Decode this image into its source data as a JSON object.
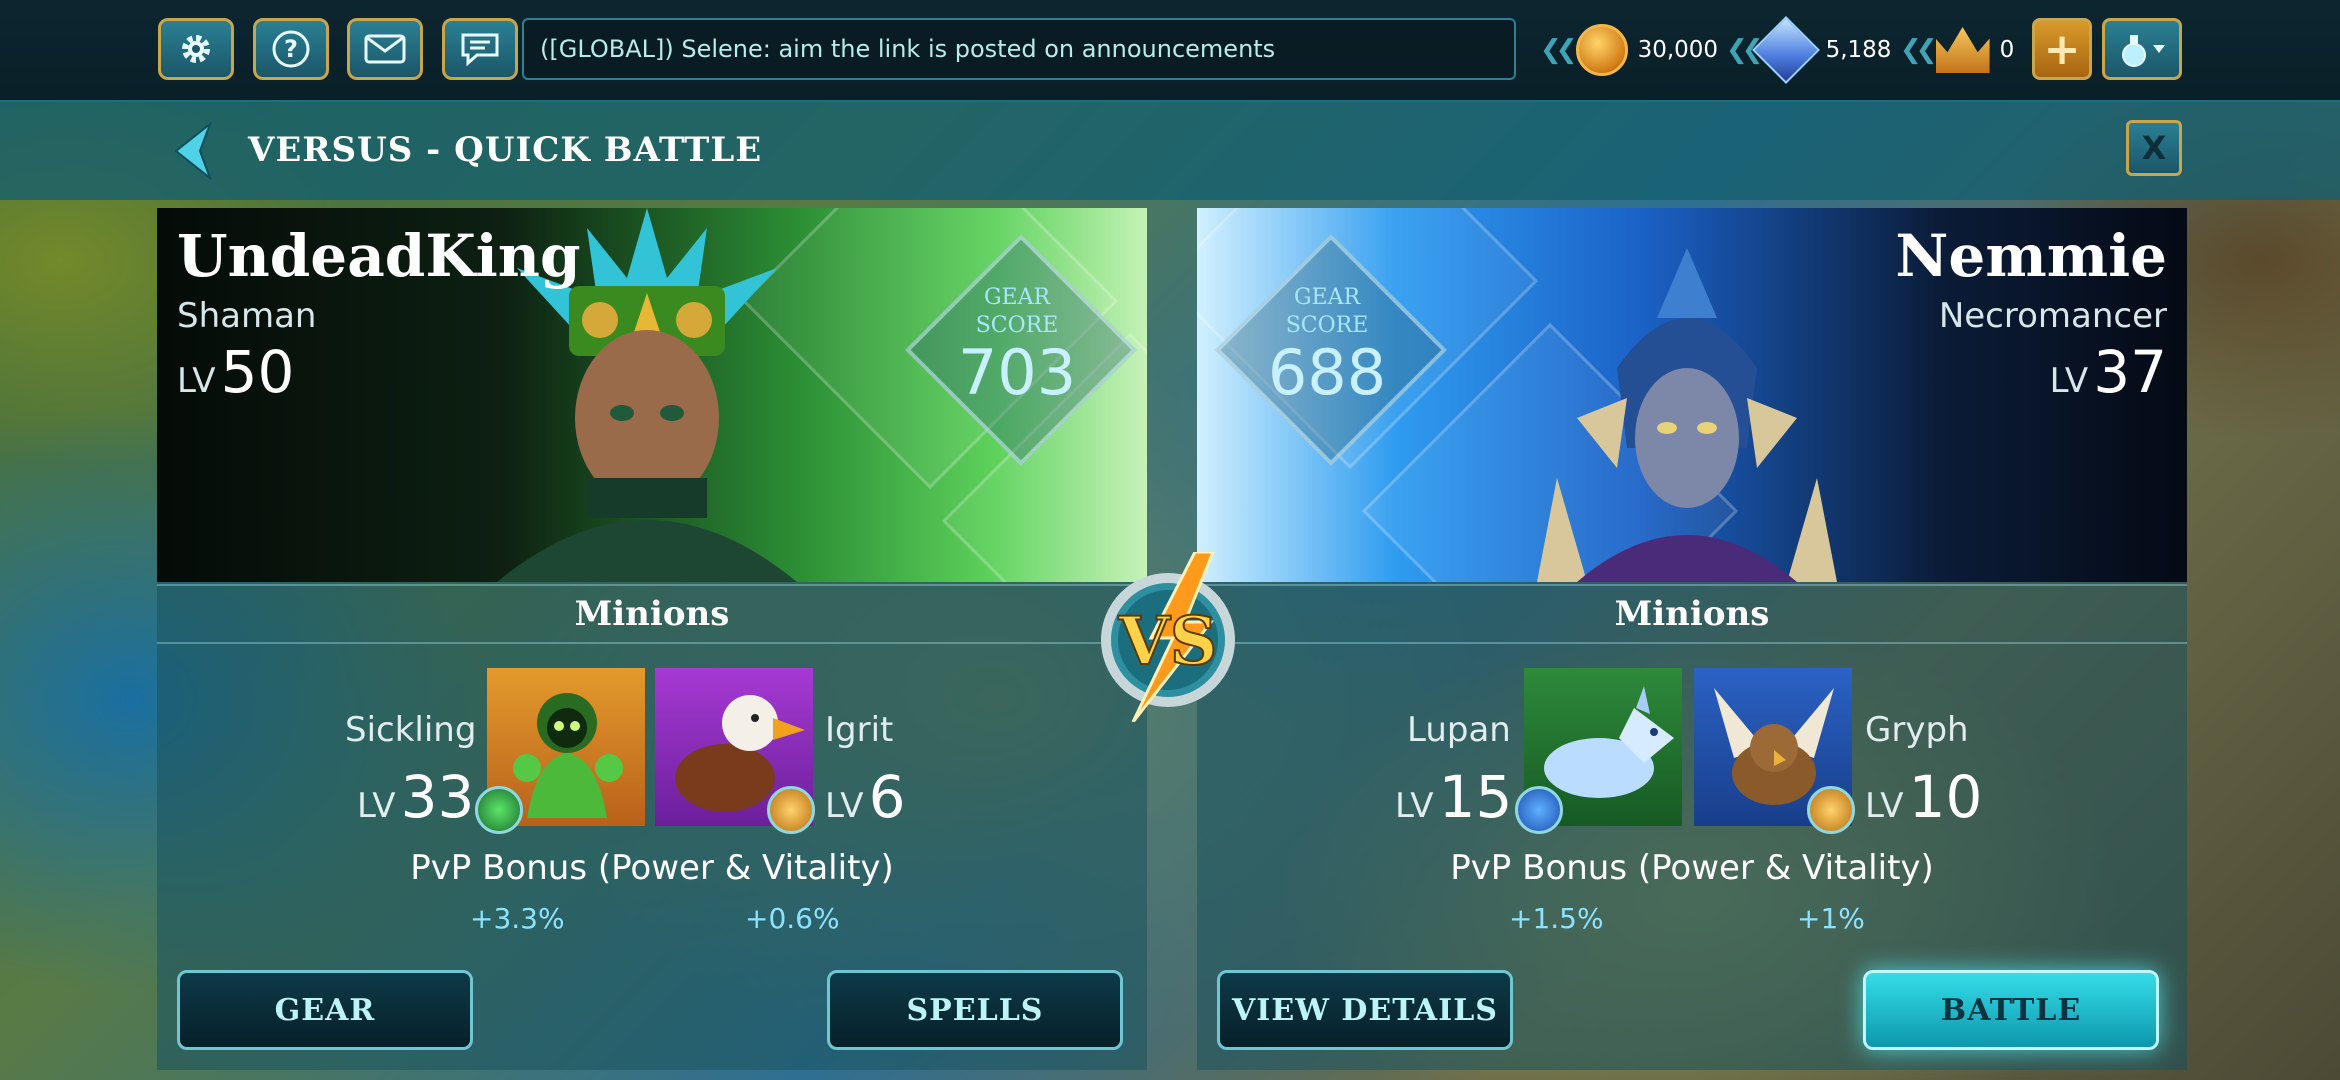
{
  "topbar": {
    "chat_message": "([GLOBAL]) Selene: aim the link is posted on announcements",
    "gold": "30,000",
    "gems": "5,188",
    "crowns": "0"
  },
  "header": {
    "title": "VERSUS - QUICK BATTLE",
    "close_label": "X"
  },
  "player": {
    "name": "UndeadKing",
    "class": "Shaman",
    "lv_label": "LV",
    "level": "50",
    "gear_label_1": "GEAR",
    "gear_label_2": "SCORE",
    "gear_score": "703",
    "minions_title": "Minions",
    "minion1": {
      "name": "Sickling",
      "lv_label": "LV",
      "level": "33"
    },
    "minion2": {
      "name": "Igrit",
      "lv_label": "LV",
      "level": "6"
    },
    "bonus_title": "PvP Bonus (Power & Vitality)",
    "bonus1": "+3.3%",
    "bonus2": "+0.6%",
    "button_left": "GEAR",
    "button_right": "SPELLS"
  },
  "opponent": {
    "name": "Nemmie",
    "class": "Necromancer",
    "lv_label": "LV",
    "level": "37",
    "gear_label_1": "GEAR",
    "gear_label_2": "SCORE",
    "gear_score": "688",
    "minions_title": "Minions",
    "minion1": {
      "name": "Lupan",
      "lv_label": "LV",
      "level": "15"
    },
    "minion2": {
      "name": "Gryph",
      "lv_label": "LV",
      "level": "10"
    },
    "bonus_title": "PvP Bonus (Power & Vitality)",
    "bonus1": "+1.5%",
    "bonus2": "+1%",
    "button_left": "VIEW DETAILS",
    "button_right": "BATTLE"
  },
  "vs_label": "VS",
  "colors": {
    "accent": "#35dde8",
    "gold_border": "#c9a54b",
    "player_bg": "#2c8f35",
    "opponent_bg": "#1b61c6"
  }
}
